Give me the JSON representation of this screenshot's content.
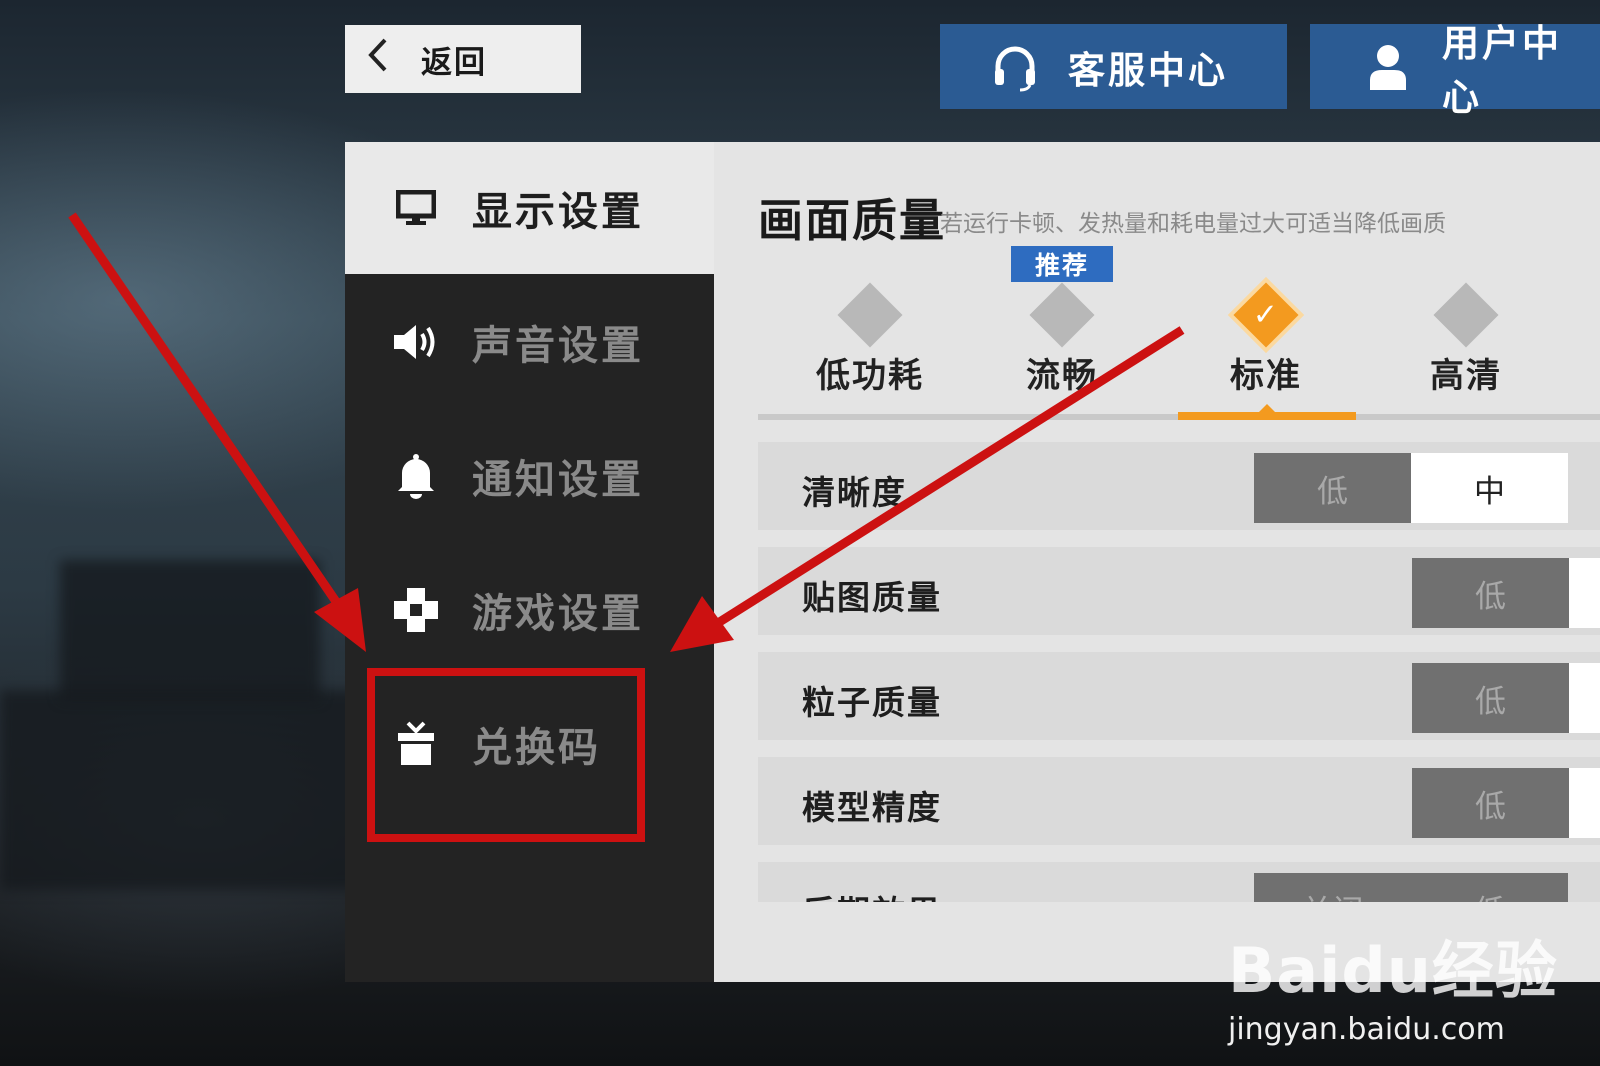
{
  "topbar": {
    "back_label": "返回",
    "service_label": "客服中心",
    "user_label": "用户中心"
  },
  "sidebar": {
    "items": [
      {
        "label": "显示设置",
        "icon": "monitor-icon",
        "active": true
      },
      {
        "label": "声音设置",
        "icon": "speaker-icon"
      },
      {
        "label": "通知设置",
        "icon": "bell-icon"
      },
      {
        "label": "游戏设置",
        "icon": "gamepad-icon"
      },
      {
        "label": "兑换码",
        "icon": "gift-icon"
      }
    ]
  },
  "quality": {
    "title": "画面质量",
    "hint": "若运行卡顿、发热量和耗电量过大可适当降低画质",
    "recommend_tag": "推荐",
    "options": [
      "低功耗",
      "流畅",
      "标准",
      "高清"
    ],
    "selected": "标准",
    "check_glyph": "✓"
  },
  "settings": {
    "rows": [
      {
        "label": "清晰度",
        "options": [
          "低",
          "中"
        ],
        "selected": "中"
      },
      {
        "label": "贴图质量",
        "options": [
          "低"
        ]
      },
      {
        "label": "粒子质量",
        "options": [
          "低"
        ]
      },
      {
        "label": "模型精度",
        "options": [
          "低"
        ]
      },
      {
        "label": "后期效果",
        "options": [
          "关闭",
          "低"
        ]
      }
    ]
  },
  "watermark": {
    "logo": "Baidu经验",
    "url": "jingyan.baidu.com"
  },
  "colors": {
    "accent_orange": "#f39a1f",
    "button_blue": "#2b5b93",
    "tag_blue": "#2e6cc0",
    "annotation_red": "#cc1111"
  }
}
